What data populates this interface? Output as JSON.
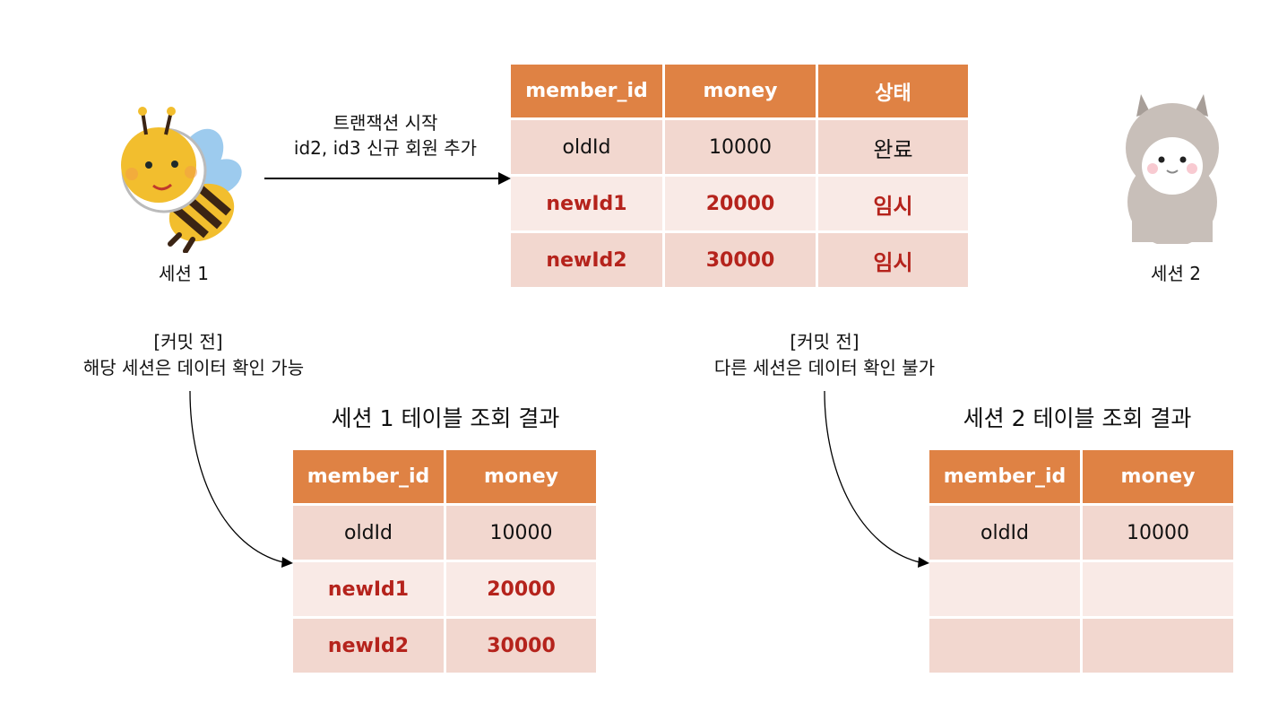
{
  "colors": {
    "header": "#DF8244",
    "row_dark": "#F2D7CF",
    "row_light": "#F9EAE6",
    "temp_text": "#B5231C"
  },
  "arrow_label": {
    "line1": "트랜잭션 시작",
    "line2": "id2, id3 신규 회원 추가"
  },
  "session1_label": "세션 1",
  "session2_label": "세션 2",
  "main_table": {
    "headers": [
      "member_id",
      "money",
      "상태"
    ],
    "rows": [
      [
        "oldId",
        "10000",
        "완료"
      ],
      [
        "newId1",
        "20000",
        "임시"
      ],
      [
        "newId2",
        "30000",
        "임시"
      ]
    ]
  },
  "note_left": {
    "line1": "[커밋 전]",
    "line2": "해당 세션은 데이터 확인 가능"
  },
  "note_right": {
    "line1": "[커밋 전]",
    "line2": "다른 세션은 데이터 확인 불가"
  },
  "session1_result": {
    "title": "세션 1 테이블 조회 결과",
    "headers": [
      "member_id",
      "money"
    ],
    "rows": [
      [
        "oldId",
        "10000"
      ],
      [
        "newId1",
        "20000"
      ],
      [
        "newId2",
        "30000"
      ]
    ]
  },
  "session2_result": {
    "title": "세션 2 테이블 조회 결과",
    "headers": [
      "member_id",
      "money"
    ],
    "rows": [
      [
        "oldId",
        "10000"
      ],
      [
        "",
        ""
      ],
      [
        "",
        ""
      ]
    ]
  }
}
